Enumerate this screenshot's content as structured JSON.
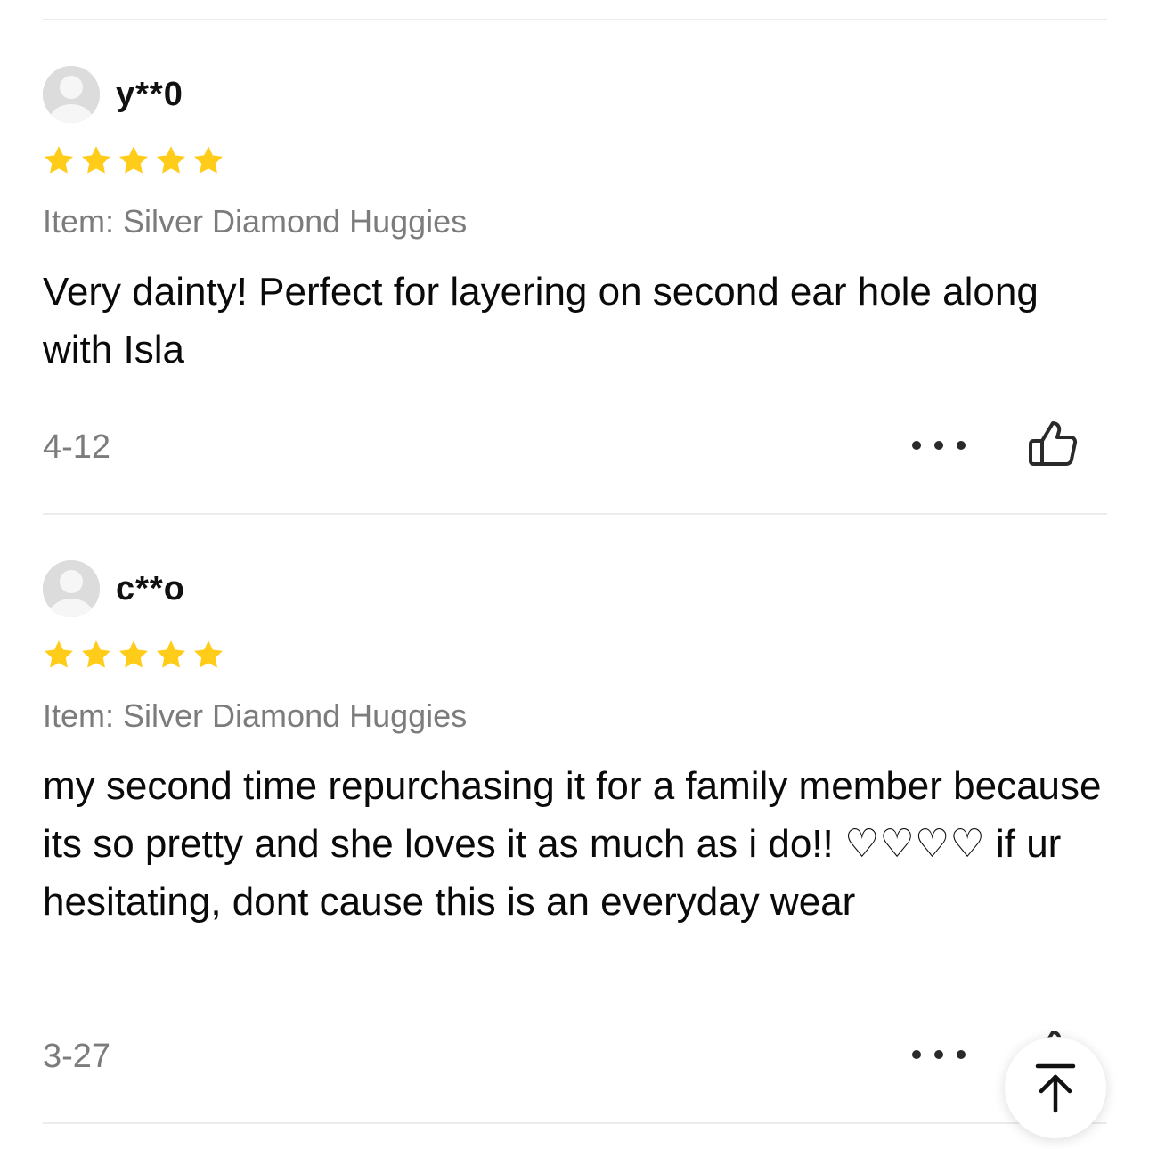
{
  "reviews": [
    {
      "username": "y**0",
      "rating": 5,
      "item": "Item: Silver Diamond Huggies",
      "text": "Very dainty! Perfect for layering on second ear hole along with Isla",
      "date": "4-12"
    },
    {
      "username": "c**o",
      "rating": 5,
      "item": "Item: Silver Diamond Huggies",
      "text": "my second time repurchasing it for a family member because its so pretty and she loves it as much as i do!! ♡♡♡♡ if ur hesitating, dont cause this is an everyday wear",
      "date": "3-27"
    }
  ],
  "icons": {
    "avatar": "user-avatar-icon",
    "star": "star-icon",
    "more": "more-options-icon",
    "like": "thumbs-up-icon",
    "back_to_top": "arrow-up-to-top-icon"
  },
  "colors": {
    "star": "#FFCC1A",
    "secondary_text": "#7C7C7C",
    "divider": "#ECECEC",
    "avatar_bg": "#DCDCDC"
  }
}
